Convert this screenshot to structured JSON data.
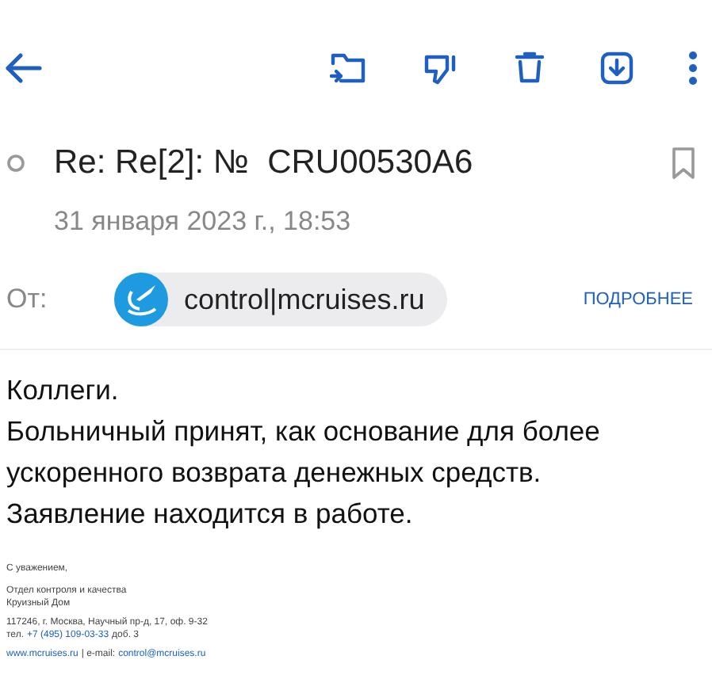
{
  "message": {
    "subject": "Re: Re[2]: №  CRU00530A6",
    "date": "31 января 2023 г., 18:53",
    "from_label": "От:",
    "sender": "control|mcruises.ru",
    "details_link": "ПОДРОБНЕЕ"
  },
  "body": [
    "Коллеги.",
    "Больничный принят, как основание для более ускоренного возврата денежных средств.",
    "Заявление находится в работе."
  ],
  "signature": {
    "greeting": "С уважением,",
    "department": [
      "Отдел контроля и качества",
      "Круизный Дом"
    ],
    "address": "117246, г. Москва, Научный пр-д, 17, оф. 9-32",
    "phone": {
      "prefix": "тел.",
      "number": "+7 (495) 109-03-33",
      "suffix": "доб. 3"
    },
    "website": "www.mcruises.ru",
    "separator": "| e-mail:",
    "email": "control@mcruises.ru"
  }
}
